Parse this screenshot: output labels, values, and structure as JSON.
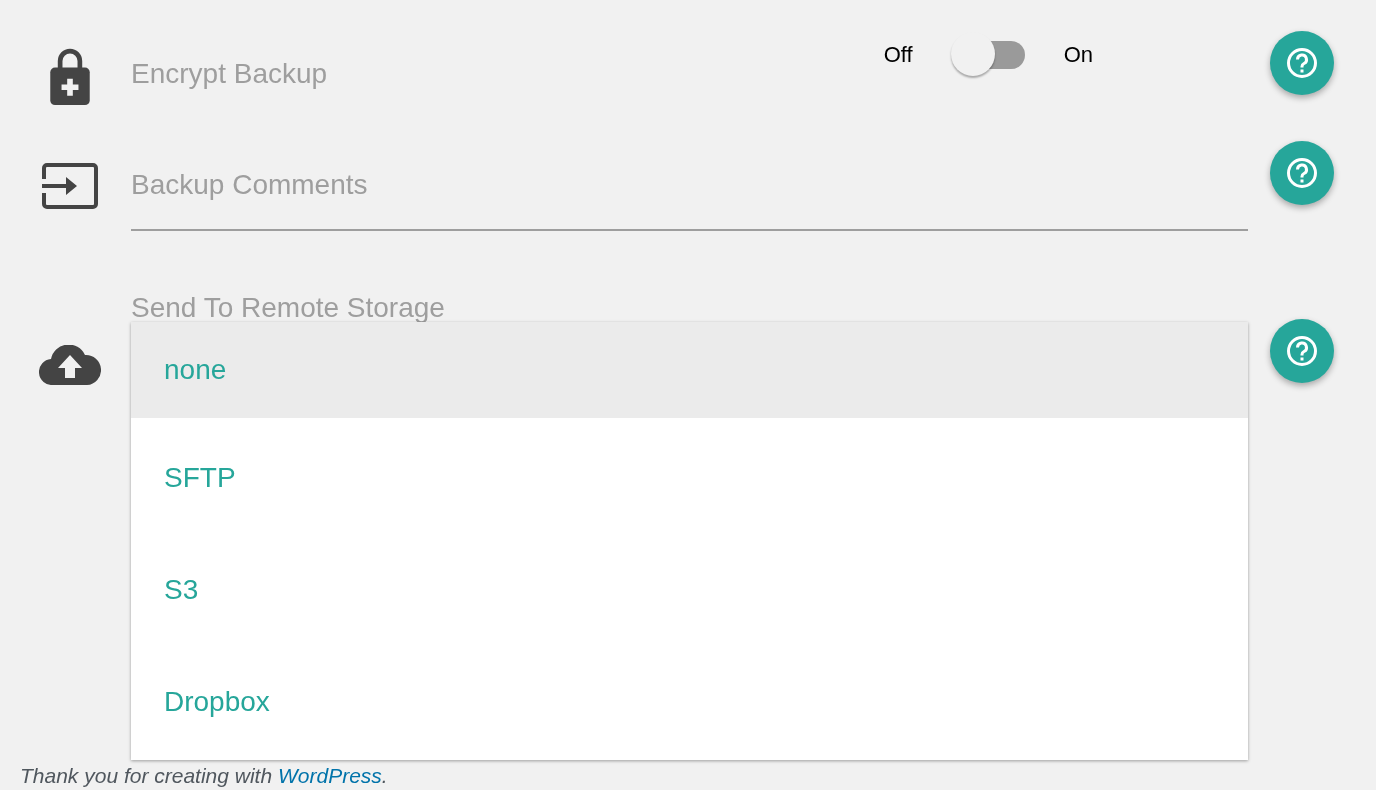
{
  "settings": [
    {
      "kind": "toggle",
      "label": "Encrypt Backup",
      "off_label": "Off",
      "on_label": "On",
      "on": false
    },
    {
      "kind": "text",
      "placeholder": "Backup Comments"
    },
    {
      "kind": "select",
      "label": "Send To Remote Storage",
      "open": true,
      "options": [
        {
          "label": "none",
          "selected": true
        },
        {
          "label": "SFTP",
          "selected": false
        },
        {
          "label": "S3",
          "selected": false
        },
        {
          "label": "Dropbox",
          "selected": false
        }
      ]
    }
  ],
  "footer": {
    "text": "Thank you for creating with ",
    "link": "WordPress",
    "end": "."
  }
}
